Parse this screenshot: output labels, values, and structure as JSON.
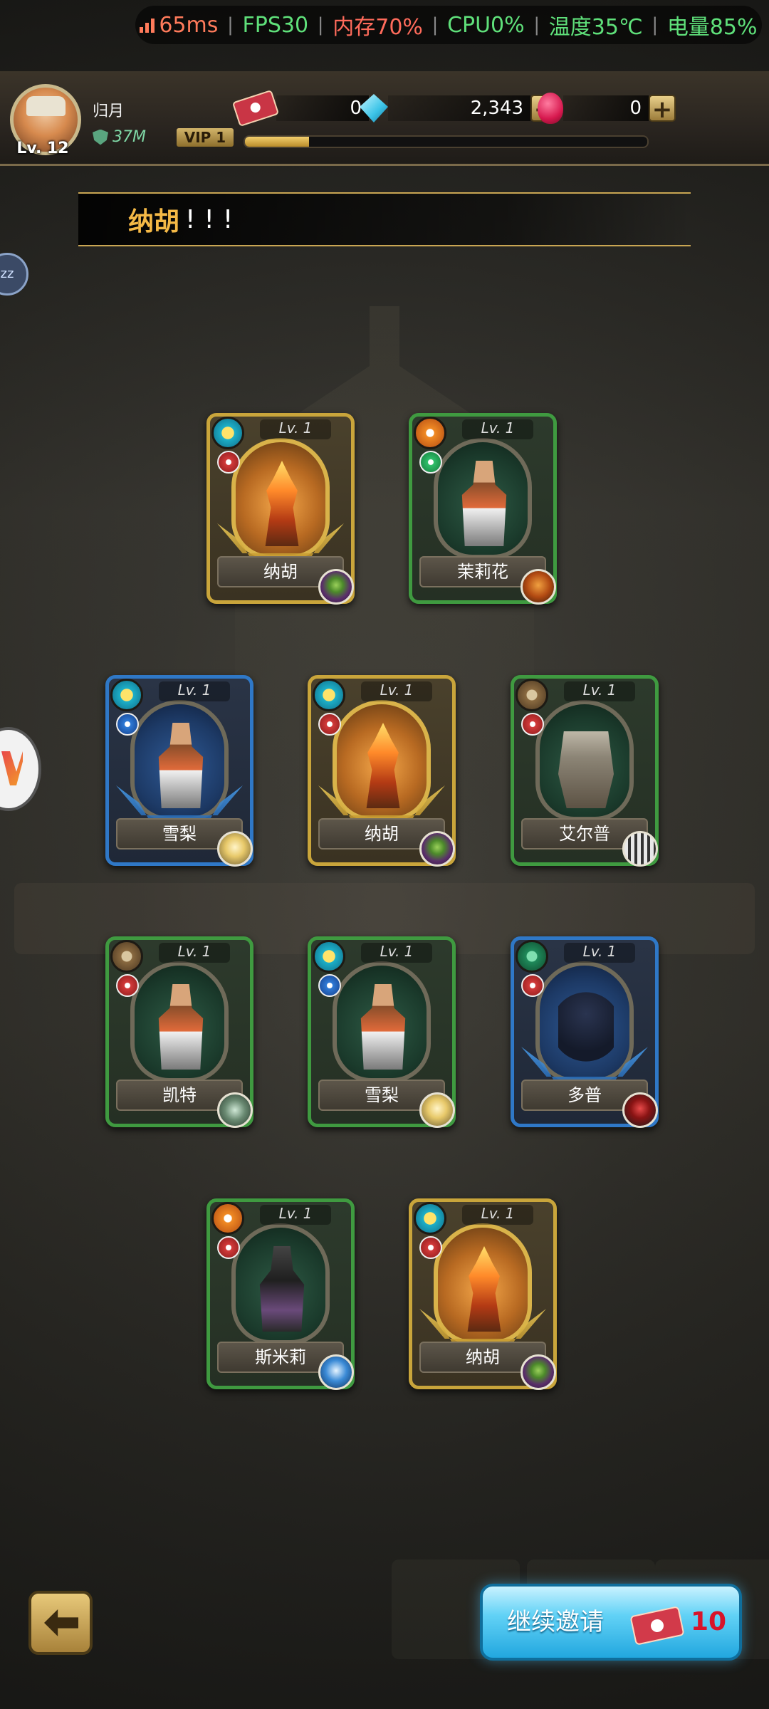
{
  "status": {
    "ping": "65ms",
    "fps": "FPS30",
    "memory": "内存70%",
    "cpu": "CPU0%",
    "temp": "温度35℃",
    "battery": "电量85%",
    "colors": {
      "ping": "#ff7b5b",
      "fps": "#5fe07a",
      "memory": "#ff6b5b",
      "cpu": "#5fe07a",
      "temp": "#5fe07a",
      "battery": "#5fe07a"
    }
  },
  "player": {
    "name": "归月",
    "level": "Lv. 12",
    "power": "37M",
    "vip": "VIP  1",
    "vip_progress": 0.16
  },
  "resources": {
    "tickets": "0",
    "diamonds": "2,343",
    "rubies": "0"
  },
  "message": {
    "hero": "纳胡",
    "exclaim": "!!!"
  },
  "cards": [
    {
      "name": "纳胡",
      "level": "Lv. 1",
      "rarity": "gold",
      "class_icon": "teal-crown-icon",
      "figure": "flame"
    },
    {
      "name": "茉莉花",
      "level": "Lv. 1",
      "rarity": "green",
      "class_icon": "orange-boot-icon",
      "figure": "person"
    },
    {
      "name": "雪梨",
      "level": "Lv. 1",
      "rarity": "blue",
      "class_icon": "teal-crown-icon",
      "figure": "person"
    },
    {
      "name": "纳胡",
      "level": "Lv. 1",
      "rarity": "gold",
      "class_icon": "teal-crown-icon",
      "figure": "flame"
    },
    {
      "name": "艾尔普",
      "level": "Lv. 1",
      "rarity": "green",
      "class_icon": "brown-hat-icon",
      "figure": "mech"
    },
    {
      "name": "凯特",
      "level": "Lv. 1",
      "rarity": "green",
      "class_icon": "brown-hat-icon",
      "figure": "person"
    },
    {
      "name": "雪梨",
      "level": "Lv. 1",
      "rarity": "green",
      "class_icon": "teal-crown-icon",
      "figure": "person"
    },
    {
      "name": "多普",
      "level": "Lv. 1",
      "rarity": "blue",
      "class_icon": "forest-tree-icon",
      "figure": "golem"
    },
    {
      "name": "斯米莉",
      "level": "Lv. 1",
      "rarity": "green",
      "class_icon": "orange-boot-icon",
      "figure": "dark"
    },
    {
      "name": "纳胡",
      "level": "Lv. 1",
      "rarity": "gold",
      "class_icon": "teal-crown-icon",
      "figure": "flame"
    }
  ],
  "actions": {
    "continue_invite": "继续邀请",
    "invite_cost": "10"
  }
}
